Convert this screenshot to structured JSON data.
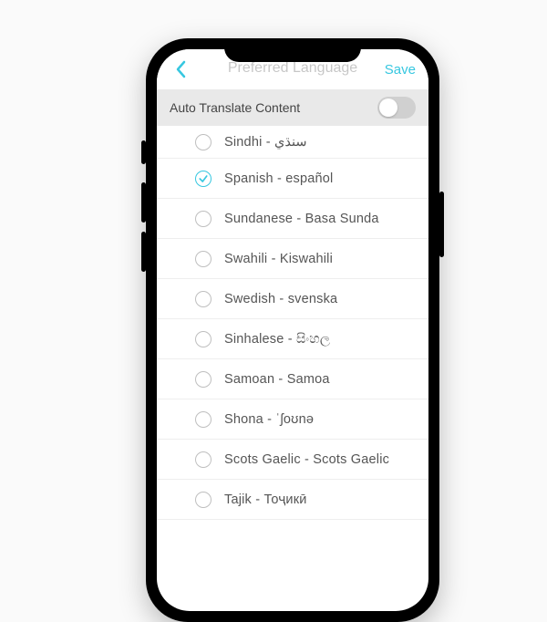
{
  "header": {
    "title": "Preferred Language",
    "save": "Save"
  },
  "autoTranslate": {
    "label": "Auto Translate Content",
    "enabled": false
  },
  "colors": {
    "accent": "#37c7e0"
  },
  "languages": [
    {
      "label": "Sindhi - سنڌي",
      "selected": false
    },
    {
      "label": "Spanish - español",
      "selected": true
    },
    {
      "label": "Sundanese - Basa Sunda",
      "selected": false
    },
    {
      "label": "Swahili - Kiswahili",
      "selected": false
    },
    {
      "label": "Swedish - svenska",
      "selected": false
    },
    {
      "label": "Sinhalese - සිංහල",
      "selected": false
    },
    {
      "label": "Samoan - Samoa",
      "selected": false
    },
    {
      "label": "Shona - ˈʃoʊnə",
      "selected": false
    },
    {
      "label": "Scots Gaelic - Scots Gaelic",
      "selected": false
    },
    {
      "label": "Tajik - Тоҷикӣ",
      "selected": false
    }
  ]
}
